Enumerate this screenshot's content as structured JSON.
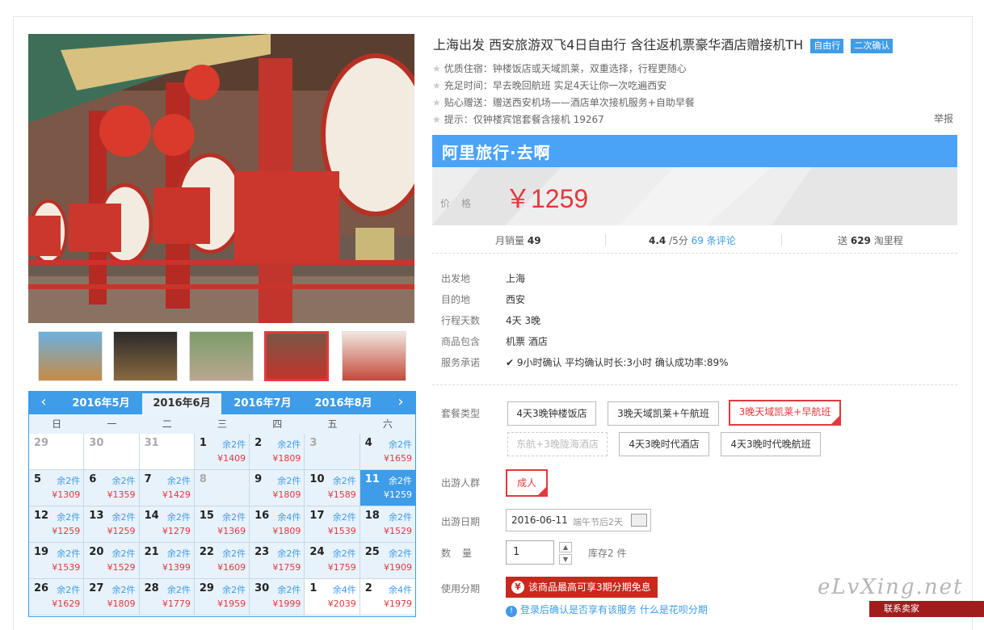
{
  "product": {
    "title": "上海出发 西安旅游双飞4日自由行 含往返机票豪华酒店赠接机TH",
    "tags": [
      "自由行",
      "二次确认"
    ],
    "features": [
      "优质住宿：钟楼饭店或天域凯莱，双重选择，行程更随心",
      "充足时间：早去晚回航班 实足4天让你一次吃遍西安",
      "贴心赠送：赠送西安机场——酒店单次接机服务+自助早餐",
      "提示：仅钟楼宾馆套餐含接机 19267"
    ],
    "report": "举报",
    "brand": "阿里旅行·去啊",
    "price_label": "价格",
    "price": "￥1259"
  },
  "stats": {
    "monthly_label": "月销量",
    "monthly": "49",
    "rating": "4.4",
    "rating_suffix": "/5分",
    "reviews": "69 条评论",
    "points_prefix": "送",
    "points": "629",
    "points_suffix": "淘里程"
  },
  "info": [
    {
      "k": "出发地",
      "v": "上海"
    },
    {
      "k": "目的地",
      "v": "西安"
    },
    {
      "k": "行程天数",
      "v": "4天 3晚"
    },
    {
      "k": "商品包含",
      "v": "机票   酒店"
    },
    {
      "k": "服务承诺",
      "v": "9小时确认   平均确认时长:3小时   确认成功率:89%"
    }
  ],
  "package": {
    "label": "套餐类型",
    "options": [
      "4天3晚钟楼饭店",
      "3晚天域凯莱+午航班",
      "3晚天域凯莱+早航班",
      "东航+3晚陇海酒店",
      "4天3晚时代酒店",
      "4天3晚时代晚航班"
    ]
  },
  "group": {
    "label": "出游人群",
    "value": "成人"
  },
  "date": {
    "label": "出游日期",
    "value": "2016-06-11",
    "hint": "端午节后2天"
  },
  "quantity": {
    "label": "数量",
    "value": "1",
    "stock": "库存2 件"
  },
  "installment": {
    "label": "使用分期",
    "banner": "该商品最高可享3期分期免息",
    "note": "登录后确认是否享有该服务",
    "link": "什么是花呗分期"
  },
  "calendar": {
    "months": [
      "2016年5月",
      "2016年6月",
      "2016年7月",
      "2016年8月"
    ],
    "weekdays": [
      "日",
      "一",
      "二",
      "三",
      "四",
      "五",
      "六"
    ],
    "cells": [
      {
        "d": "29",
        "s": "",
        "p": ""
      },
      {
        "d": "30",
        "s": "",
        "p": ""
      },
      {
        "d": "31",
        "s": "",
        "p": ""
      },
      {
        "d": "1",
        "s": "余2件",
        "p": "¥1409"
      },
      {
        "d": "2",
        "s": "余2件",
        "p": "¥1809"
      },
      {
        "d": "3",
        "s": "",
        "p": ""
      },
      {
        "d": "4",
        "s": "余2件",
        "p": "¥1659"
      },
      {
        "d": "5",
        "s": "余2件",
        "p": "¥1309"
      },
      {
        "d": "6",
        "s": "余2件",
        "p": "¥1359"
      },
      {
        "d": "7",
        "s": "余2件",
        "p": "¥1429"
      },
      {
        "d": "8",
        "s": "",
        "p": ""
      },
      {
        "d": "9",
        "s": "余2件",
        "p": "¥1809"
      },
      {
        "d": "10",
        "s": "余2件",
        "p": "¥1589"
      },
      {
        "d": "11",
        "s": "余2件",
        "p": "¥1259"
      },
      {
        "d": "12",
        "s": "余2件",
        "p": "¥1259"
      },
      {
        "d": "13",
        "s": "余2件",
        "p": "¥1259"
      },
      {
        "d": "14",
        "s": "余2件",
        "p": "¥1279"
      },
      {
        "d": "15",
        "s": "余2件",
        "p": "¥1369"
      },
      {
        "d": "16",
        "s": "余4件",
        "p": "¥1809"
      },
      {
        "d": "17",
        "s": "余2件",
        "p": "¥1539"
      },
      {
        "d": "18",
        "s": "余2件",
        "p": "¥1529"
      },
      {
        "d": "19",
        "s": "余2件",
        "p": "¥1539"
      },
      {
        "d": "20",
        "s": "余2件",
        "p": "¥1529"
      },
      {
        "d": "21",
        "s": "余2件",
        "p": "¥1399"
      },
      {
        "d": "22",
        "s": "余2件",
        "p": "¥1609"
      },
      {
        "d": "23",
        "s": "余2件",
        "p": "¥1759"
      },
      {
        "d": "24",
        "s": "余2件",
        "p": "¥1759"
      },
      {
        "d": "25",
        "s": "余2件",
        "p": "¥1909"
      },
      {
        "d": "26",
        "s": "余2件",
        "p": "¥1629"
      },
      {
        "d": "27",
        "s": "余2件",
        "p": "¥1809"
      },
      {
        "d": "28",
        "s": "余2件",
        "p": "¥1779"
      },
      {
        "d": "29",
        "s": "余2件",
        "p": "¥1959"
      },
      {
        "d": "30",
        "s": "余2件",
        "p": "¥1999"
      },
      {
        "d": "1",
        "s": "余4件",
        "p": "¥2039"
      },
      {
        "d": "2",
        "s": "余4件",
        "p": "¥1979"
      }
    ]
  },
  "watermark": "eLvXing.net",
  "corner_button": "联系卖家",
  "colors": {
    "accent": "#3e9ce8",
    "price": "#e4393c",
    "brand_bar": "#4aa3f7"
  }
}
